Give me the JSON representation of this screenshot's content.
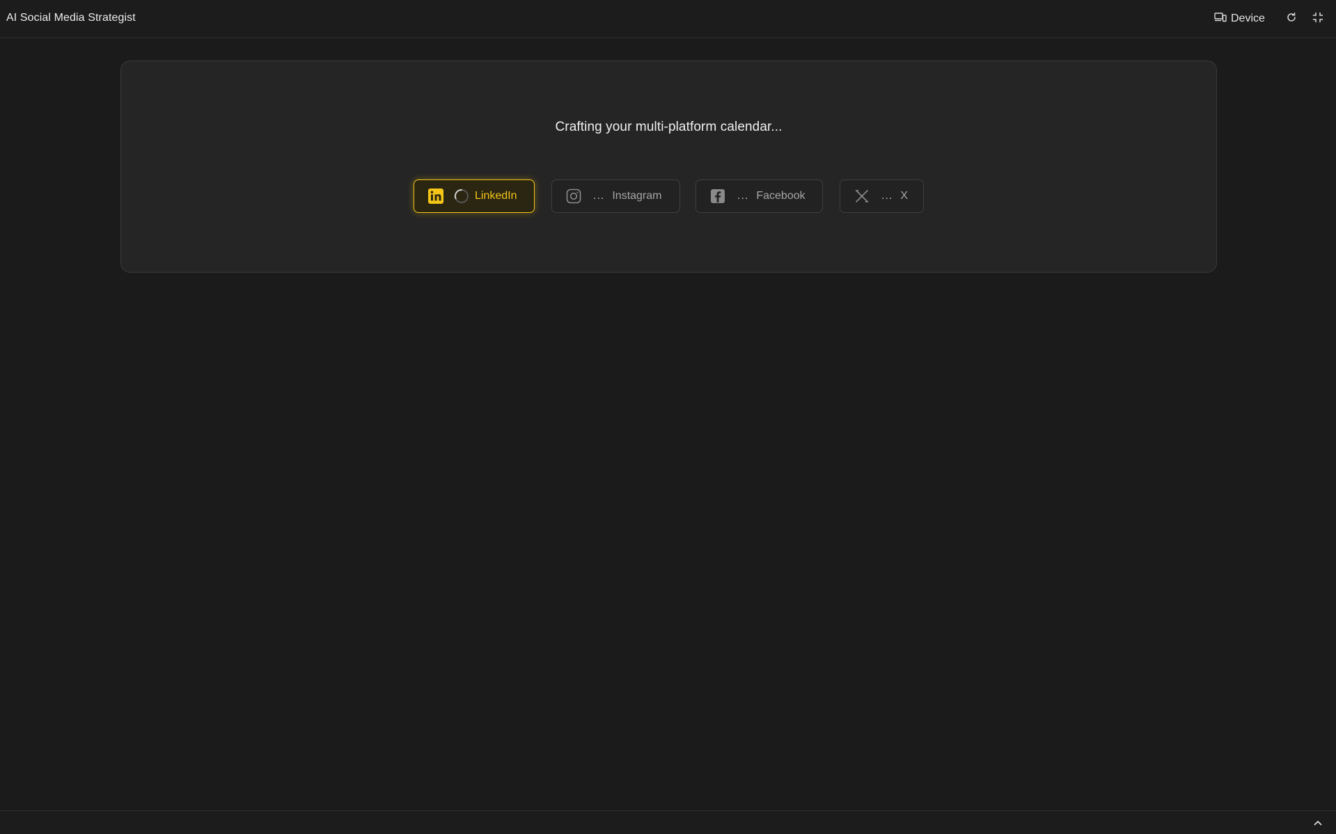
{
  "header": {
    "app_title": "AI Social Media Strategist",
    "device_label": "Device",
    "icons": [
      "device-icon",
      "refresh-icon",
      "fullscreen-icon"
    ]
  },
  "main": {
    "status_text": "Crafting your multi-platform calendar...",
    "platforms": [
      {
        "name": "LinkedIn",
        "state": "loading",
        "indicator": "",
        "icon": "linkedin-icon"
      },
      {
        "name": "Instagram",
        "state": "pending",
        "indicator": "...",
        "icon": "instagram-icon"
      },
      {
        "name": "Facebook",
        "state": "pending",
        "indicator": "...",
        "icon": "facebook-icon"
      },
      {
        "name": "X",
        "state": "pending",
        "indicator": "...",
        "icon": "x-icon"
      }
    ]
  },
  "footer": {
    "icons": [
      "chevron-up-icon"
    ]
  },
  "colors": {
    "background": "#1b1b1b",
    "card": "#252525",
    "accent": "#f5c518",
    "muted_text": "#a6a6a6"
  }
}
